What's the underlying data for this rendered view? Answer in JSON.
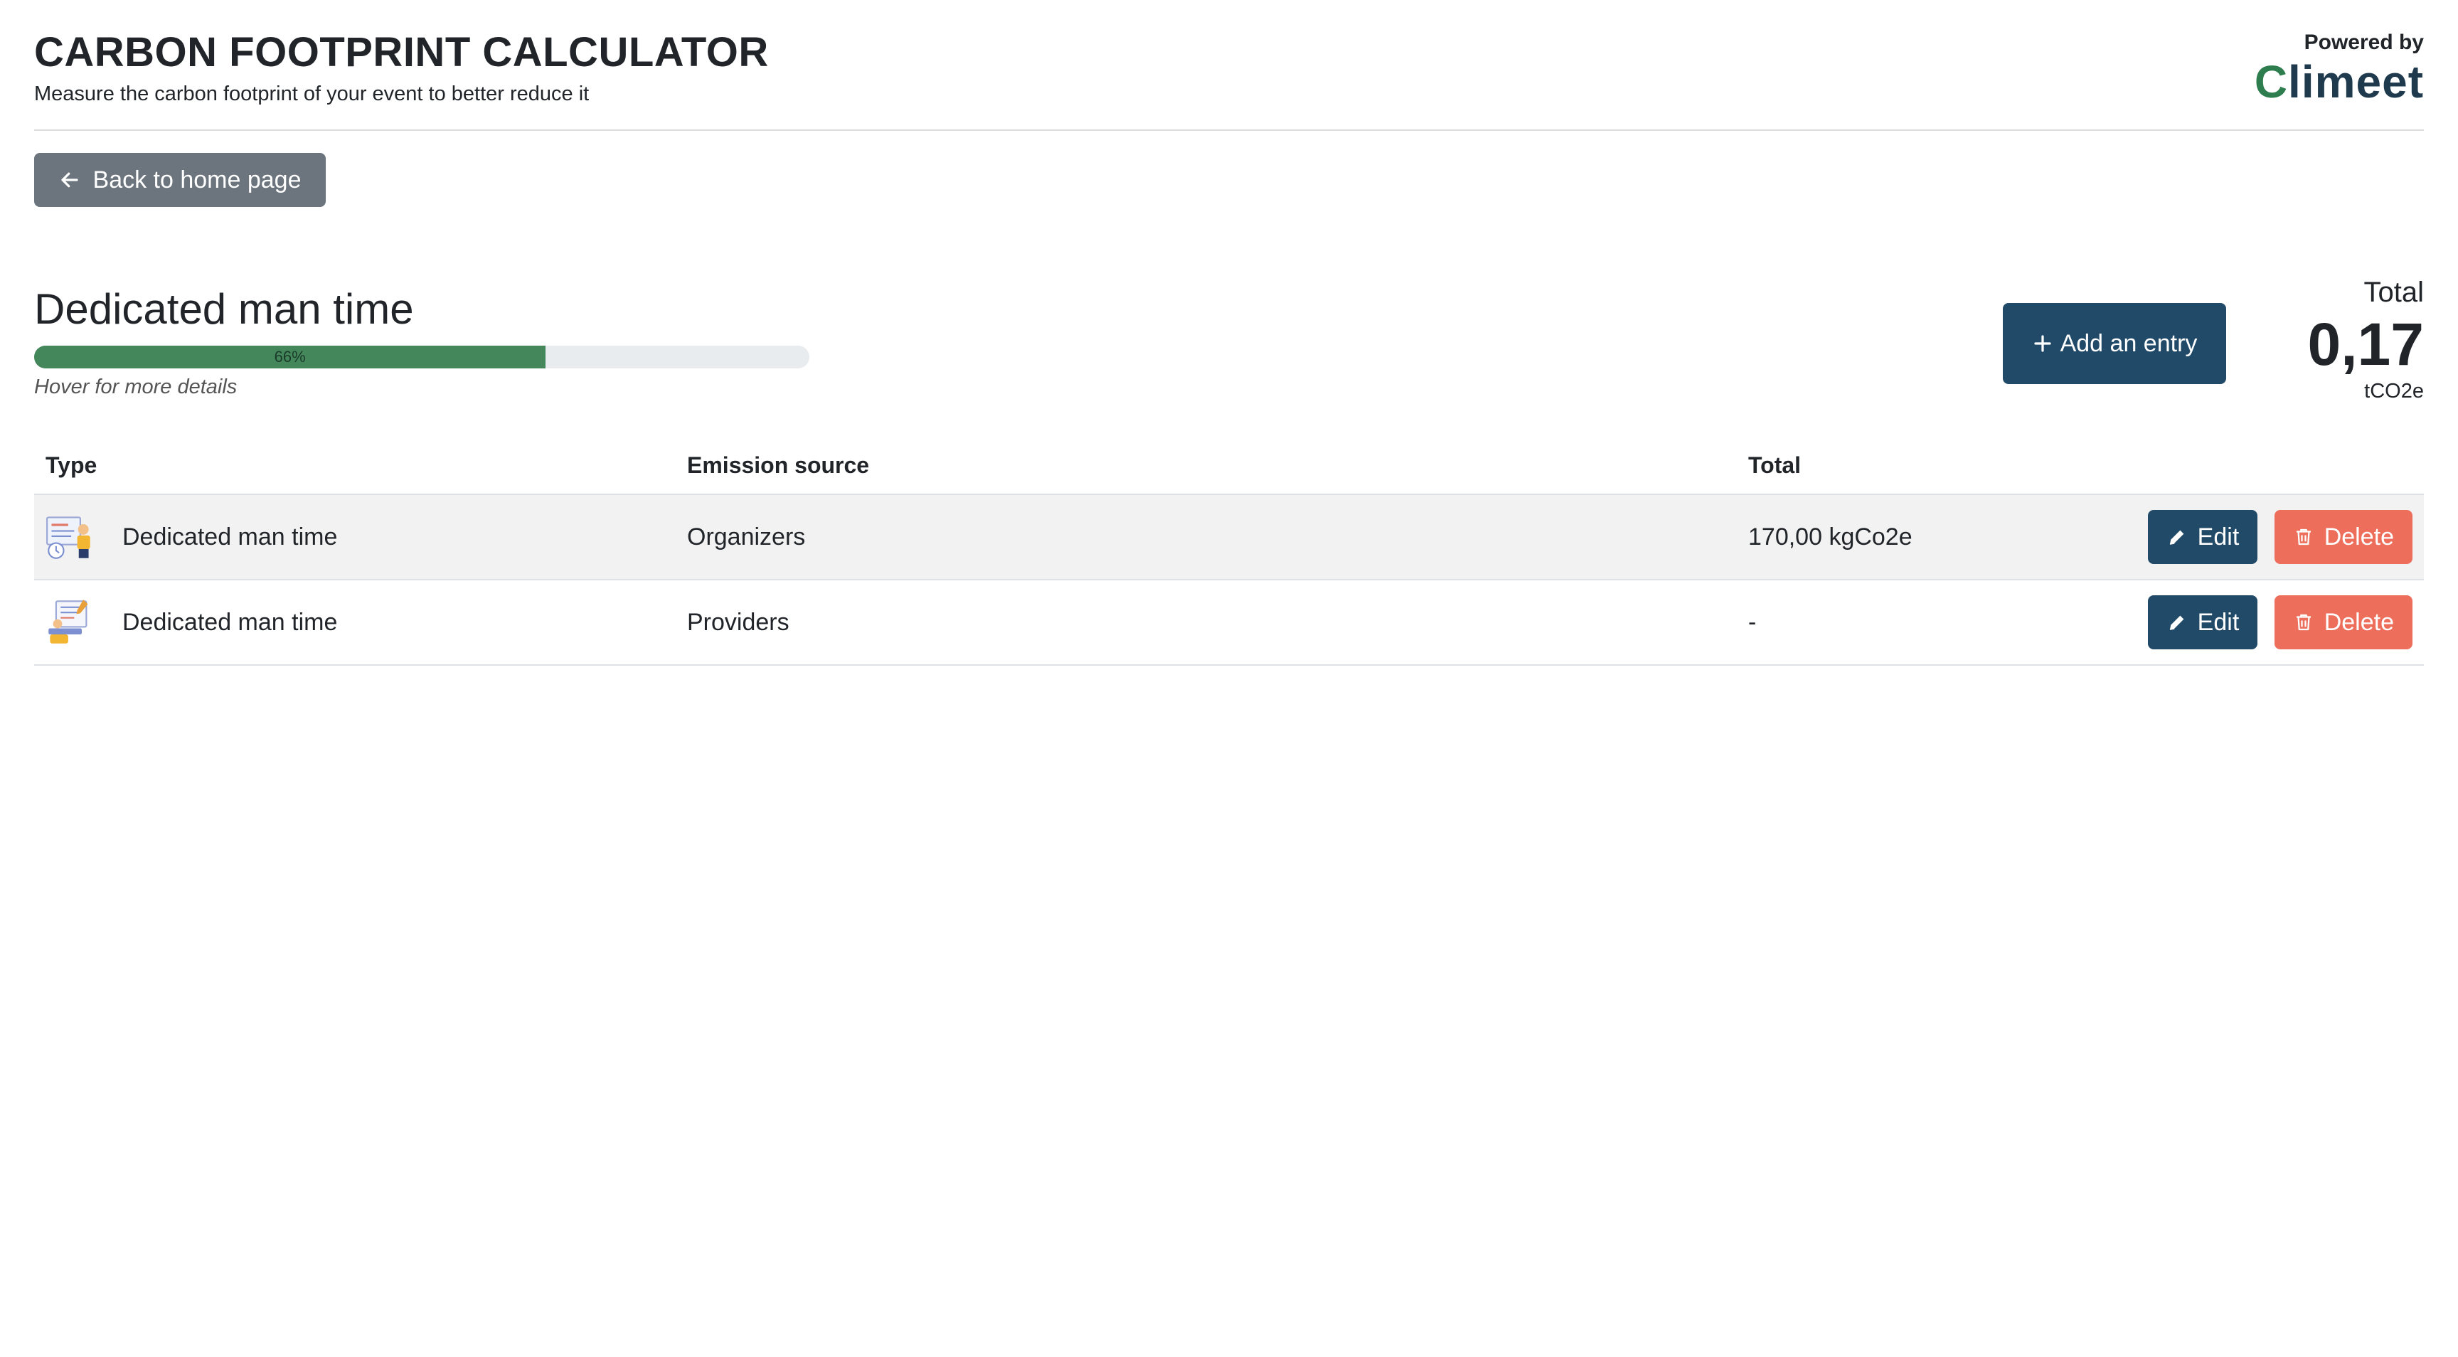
{
  "header": {
    "title": "CARBON FOOTPRINT CALCULATOR",
    "subtitle": "Measure the carbon footprint of your event to better reduce it",
    "powered_by": "Powered by",
    "brand_initial": "C",
    "brand_rest": "limeet"
  },
  "nav": {
    "back_label": "Back to home page",
    "back_icon": "arrow-left-icon"
  },
  "section": {
    "title": "Dedicated man time",
    "progress_percent": 66,
    "progress_label": "66%",
    "hint": "Hover for more details",
    "add_label": "Add an entry",
    "add_icon": "plus-icon"
  },
  "total": {
    "label": "Total",
    "value": "0,17",
    "unit": "tCO2e"
  },
  "table": {
    "headers": {
      "type": "Type",
      "source": "Emission source",
      "total": "Total"
    },
    "rows": [
      {
        "type": "Dedicated man time",
        "icon": "organizer-illustration-icon",
        "source": "Organizers",
        "total": "170,00 kgCo2e",
        "edit": "Edit",
        "delete": "Delete"
      },
      {
        "type": "Dedicated man time",
        "icon": "provider-illustration-icon",
        "source": "Providers",
        "total": "-",
        "edit": "Edit",
        "delete": "Delete"
      }
    ]
  },
  "colors": {
    "primary": "#214a68",
    "secondary": "#6c757d",
    "danger": "#ee6e5c",
    "progress": "#43875b",
    "progress_track": "#e9ecef",
    "row_shade": "#f2f2f2"
  }
}
